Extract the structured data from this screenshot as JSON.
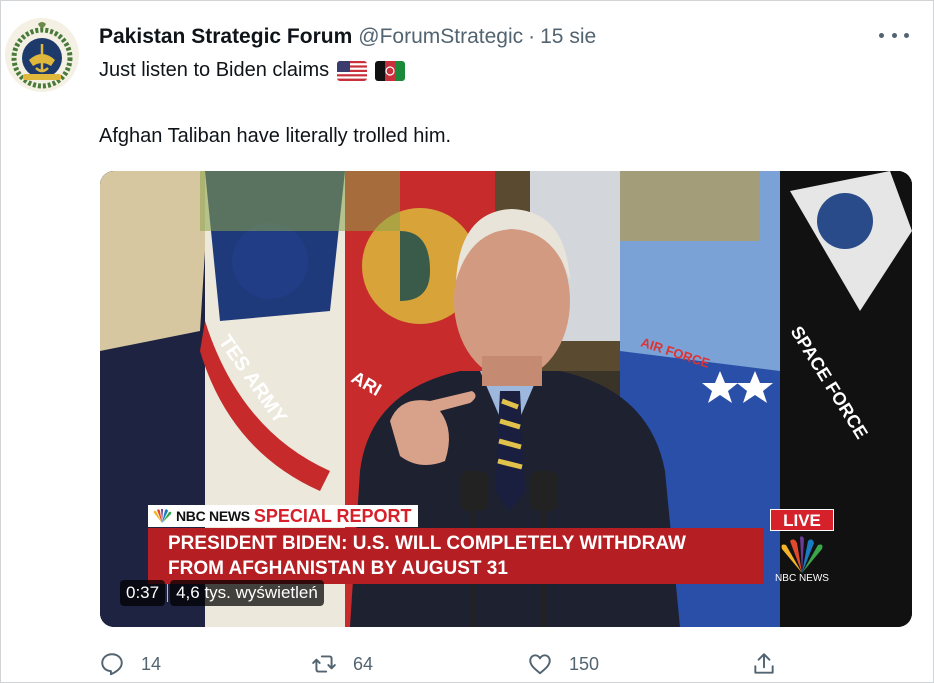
{
  "tweet": {
    "display_name": "Pakistan Strategic Forum",
    "handle": "@ForumStrategic",
    "separator": "·",
    "time": "15 sie",
    "text_line1": "Just listen to Biden claims",
    "text_line2": "Afghan Taliban have literally trolled him.",
    "flags": [
      "us-flag-icon",
      "afghanistan-flag-icon"
    ]
  },
  "video": {
    "nbc_label": "NBC NEWS",
    "special_label": "SPECIAL REPORT",
    "headline_line1": "PRESIDENT BIDEN: U.S. WILL COMPLETELY WITHDRAW",
    "headline_line2": "FROM AFGHANISTAN BY AUGUST 31",
    "live_label": "LIVE",
    "logo_text": "NBC NEWS",
    "duration": "0:37",
    "views": "4,6 tys. wyświetleń",
    "banner_texts": [
      "TES ARMY",
      "SPACE FORCE",
      "AIR FORCE",
      "ARI"
    ]
  },
  "actions": {
    "reply_count": "14",
    "retweet_count": "64",
    "like_count": "150"
  },
  "colors": {
    "text_primary": "#0f1419",
    "text_secondary": "#536471",
    "headline_red": "#b51f24",
    "live_red": "#d6202a"
  }
}
